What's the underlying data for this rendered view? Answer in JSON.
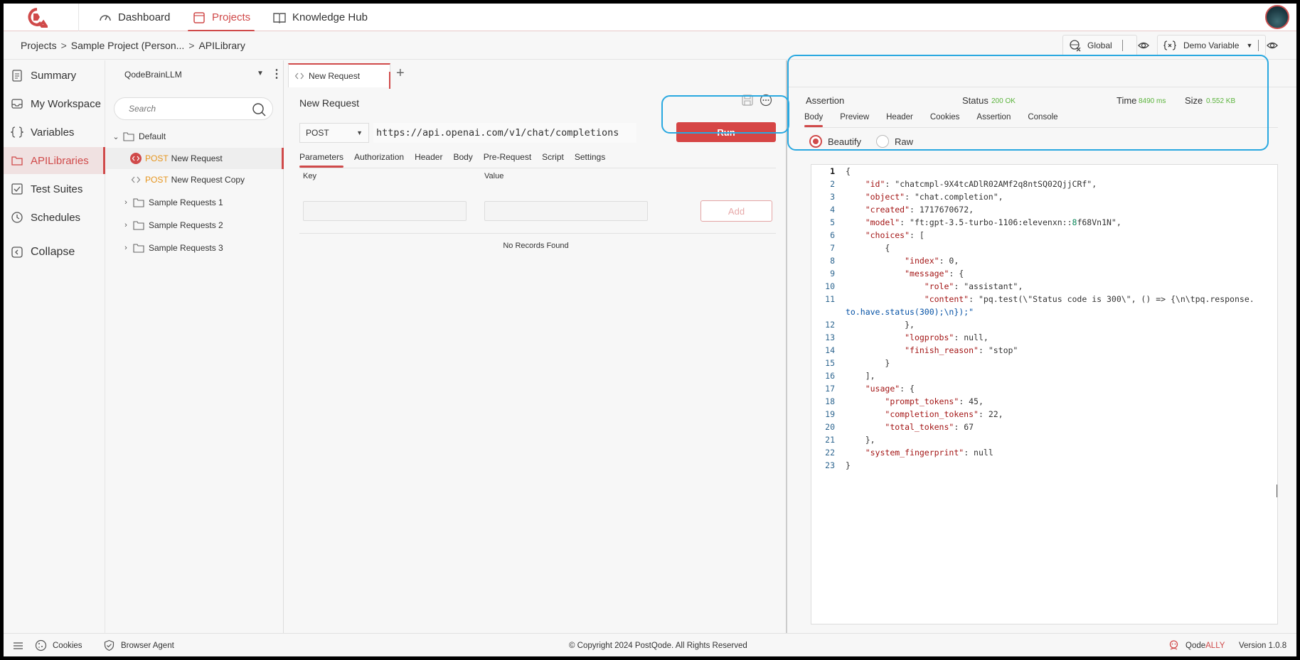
{
  "topnav": {
    "items": [
      {
        "label": "Dashboard",
        "icon": "gauge-icon"
      },
      {
        "label": "Projects",
        "icon": "folder-icon",
        "active": true
      },
      {
        "label": "Knowledge Hub",
        "icon": "book-icon"
      }
    ]
  },
  "breadcrumb": [
    "Projects",
    "Sample Project (Person...",
    "APILibrary"
  ],
  "env": {
    "global_label": "Global",
    "variable_label": "Demo Variable"
  },
  "leftnav": {
    "items": [
      {
        "label": "Summary",
        "icon": "clipboard-icon"
      },
      {
        "label": "My Workspace",
        "icon": "inbox-icon"
      },
      {
        "label": "Variables",
        "icon": "braces-icon"
      },
      {
        "label": "APILibraries",
        "icon": "folder-icon",
        "active": true
      },
      {
        "label": "Test Suites",
        "icon": "checklist-icon"
      },
      {
        "label": "Schedules",
        "icon": "clock-icon"
      }
    ],
    "collapse_label": "Collapse"
  },
  "collection": {
    "name": "QodeBrainLLM",
    "search_placeholder": "Search",
    "tree": {
      "default_folder": "Default",
      "requests": [
        {
          "method": "POST",
          "name": "New Request"
        },
        {
          "method": "POST",
          "name": "New Request Copy"
        }
      ],
      "folders": [
        "Sample Requests 1",
        "Sample Requests 2",
        "Sample Requests 3"
      ]
    }
  },
  "request": {
    "tab_label": "New Request",
    "title": "New Request",
    "method": "POST",
    "url": "https://api.openai.com/v1/chat/completions",
    "run_label": "Run",
    "tabs": [
      "Parameters",
      "Authorization",
      "Header",
      "Body",
      "Pre-Request",
      "Script",
      "Settings"
    ],
    "active_tab": "Parameters",
    "key_header": "Key",
    "value_header": "Value",
    "add_label": "Add",
    "empty_text": "No Records Found"
  },
  "response": {
    "assertion_label": "Assertion",
    "status_label": "Status",
    "status_value": "200 OK",
    "time_label": "Time",
    "time_value": "8490 ms",
    "size_label": "Size",
    "size_value": "0.552 KB",
    "tabs": [
      "Body",
      "Preview",
      "Header",
      "Cookies",
      "Assertion",
      "Console"
    ],
    "active_tab": "Body",
    "view_modes": [
      "Beautify",
      "Raw"
    ],
    "selected_view": "Beautify",
    "code_lines": [
      "{",
      "    \"id\": \"chatcmpl-9X4tcADlR02AMf2q8ntSQ02QjjCRf\",",
      "    \"object\": \"chat.completion\",",
      "    \"created\": 1717670672,",
      "    \"model\": \"ft:gpt-3.5-turbo-1106:elevenxn::8f68Vn1N\",",
      "    \"choices\": [",
      "        {",
      "            \"index\": 0,",
      "            \"message\": {",
      "                \"role\": \"assistant\",",
      "                \"content\": \"pq.test(\\\"Status code is 300\\\", () => {\\n\\tpq.response.",
      "to.have.status(300);\\n});\"",
      "            },",
      "            \"logprobs\": null,",
      "            \"finish_reason\": \"stop\"",
      "        }",
      "    ],",
      "    \"usage\": {",
      "        \"prompt_tokens\": 45,",
      "        \"completion_tokens\": 22,",
      "        \"total_tokens\": 67",
      "    },",
      "    \"system_fingerprint\": null",
      "}"
    ]
  },
  "footer": {
    "cookies_label": "Cookies",
    "browser_agent_label": "Browser Agent",
    "copyright": "© Copyright 2024 PostQode. All Rights Reserved",
    "qode_prefix": "Qode",
    "qode_suffix": "ALLY",
    "version": "Version 1.0.8"
  },
  "colors": {
    "accent": "#d04a4a",
    "highlight": "#29a8e0",
    "status_ok": "#5ab33b",
    "method_post": "#e6951e"
  }
}
